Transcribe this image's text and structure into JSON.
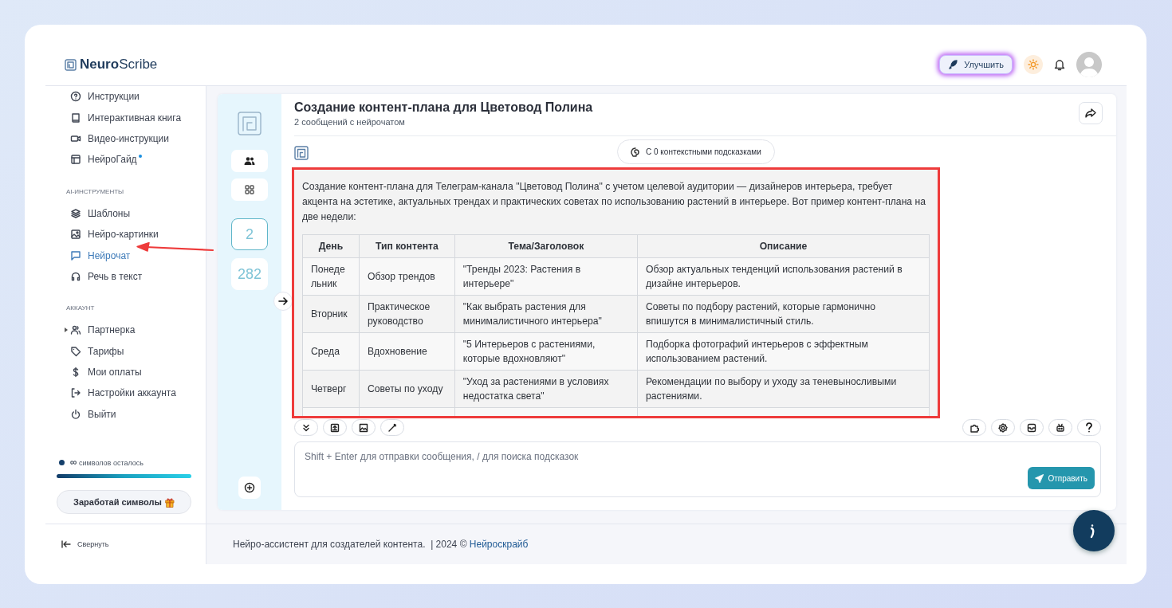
{
  "logo": {
    "bold": "Neuro",
    "light": "Scribe"
  },
  "header": {
    "upgrade_button": "Улучшить"
  },
  "sidebar": {
    "sections": [
      {
        "items": [
          {
            "label": "Инструкции",
            "selected": false,
            "badge": false
          },
          {
            "label": "Интерактивная книга",
            "selected": false,
            "badge": false
          },
          {
            "label": "Видео-инструкции",
            "selected": false,
            "badge": false
          },
          {
            "label": "НейроГайд",
            "selected": false,
            "badge": true
          }
        ]
      },
      {
        "title": "AI-ИНСТРУМЕНТЫ",
        "items": [
          {
            "label": "Шаблоны",
            "selected": false,
            "badge": false
          },
          {
            "label": "Нейро-картинки",
            "selected": false,
            "badge": false
          },
          {
            "label": "Нейрочат",
            "selected": true,
            "badge": false
          },
          {
            "label": "Речь в текст",
            "selected": false,
            "badge": false
          }
        ]
      },
      {
        "title": "АККАУНТ",
        "items": [
          {
            "label": "Партнерка",
            "selected": false,
            "badge": false,
            "expanded": false
          },
          {
            "label": "Тарифы",
            "selected": false,
            "badge": false
          },
          {
            "label": "Мои оплаты",
            "selected": false,
            "badge": false
          },
          {
            "label": "Настройки аккаунта",
            "selected": false,
            "badge": false
          },
          {
            "label": "Выйти",
            "selected": false,
            "badge": false
          }
        ]
      }
    ],
    "symbols": {
      "count": "∞",
      "label": "символов осталось",
      "level": 1
    },
    "earn_button": "Заработай символы",
    "collapse": "Свернуть"
  },
  "rail": {
    "counters": [
      {
        "label": "2",
        "selected": true
      },
      {
        "label": "282",
        "selected": false
      }
    ]
  },
  "chat": {
    "title": "Создание контент-плана для Цветовод Полина",
    "subtitle": "2 сообщений с нейрочатом",
    "hints_button": "С 0 контекстными подсказками",
    "message": {
      "text": "Создание контент-плана для Телеграм-канала \"Цветовод Полина\" с учетом целевой аудитории — дизайнеров интерьера, требует акцента на эстетике, актуальных трендах и практических советах по использованию растений в интерьере. Вот пример контент-плана на две недели:",
      "table": {
        "columns": [
          "День",
          "Тип контента",
          "Тема/Заголовок",
          "Описание"
        ],
        "rows": [
          [
            "Понеде льник",
            "Обзор трендов",
            "\"Тренды 2023: Растения в интерьере\"",
            "Обзор актуальных тенденций использования растений в дизайне интерьеров."
          ],
          [
            "Вторник",
            "Практическое руководство",
            "\"Как выбрать растения для минималистичного интерьера\"",
            "Советы по подбору растений, которые гармонично впишутся в минималистичный стиль."
          ],
          [
            "Среда",
            "Вдохновение",
            "\"5 Интерьеров с растениями, которые вдохновляют\"",
            "Подборка фотографий интерьеров с эффектным использованием растений."
          ],
          [
            "Четверг",
            "Советы по уходу",
            "\"Уход за растениями в условиях недостатка света\"",
            "Рекомендации по выбору и уходу за теневыносливыми растениями."
          ]
        ]
      }
    },
    "composer": {
      "placeholder": "Shift + Enter для отправки сообщения, / для поиска подсказок",
      "send_button": "Отправить"
    }
  },
  "footer": {
    "text": "Нейро-ассистент для создателей контента.  | 2024 © ",
    "link": "Нейроскрайб"
  }
}
